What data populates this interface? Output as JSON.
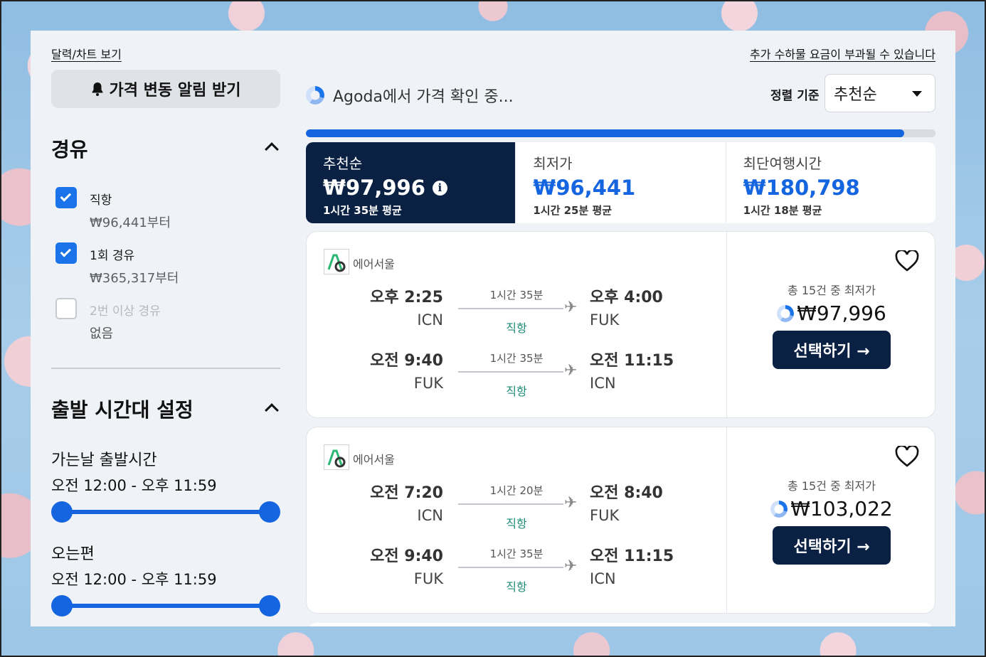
{
  "sidebar": {
    "calendar_link": "달력/차트 보기",
    "alert_button": "가격 변동 알림 받기",
    "stops": {
      "title": "경유",
      "options": [
        {
          "label": "직항",
          "price": "₩96,441부터",
          "checked": true,
          "disabled": false
        },
        {
          "label": "1회 경유",
          "price": "₩365,317부터",
          "checked": true,
          "disabled": false
        },
        {
          "label": "2번 이상 경유",
          "price": "없음",
          "checked": false,
          "disabled": true
        }
      ]
    },
    "departure_time": {
      "title": "출발 시간대 설정",
      "outbound_label": "가는날 출발시간",
      "outbound_range": "오전 12:00 - 오후 11:59",
      "return_label": "오는편",
      "return_range": "오전 12:00 - 오후 11:59"
    }
  },
  "header": {
    "baggage_notice": "추가 수하물 요금이 부과될 수 있습니다",
    "loading_text": "Agoda에서 가격 확인 중...",
    "sort_label": "정렬 기준",
    "sort_value": "추천순",
    "progress_fraction": 0.95
  },
  "tabs": [
    {
      "name": "추천순",
      "price": "₩97,996",
      "sub": "1시간 35분 평균",
      "active": true
    },
    {
      "name": "최저가",
      "price": "₩96,441",
      "sub": "1시간 25분 평균",
      "active": false
    },
    {
      "name": "최단여행시간",
      "price": "₩180,798",
      "sub": "1시간 18분 평균",
      "active": false
    }
  ],
  "flights": [
    {
      "airline": "에어서울",
      "legs": [
        {
          "dep_time": "오후 2:25",
          "dep_code": "ICN",
          "duration": "1시간 35분",
          "type": "직항",
          "arr_time": "오후 4:00",
          "arr_code": "FUK"
        },
        {
          "dep_time": "오전 9:40",
          "dep_code": "FUK",
          "duration": "1시간 35분",
          "type": "직항",
          "arr_time": "오전 11:15",
          "arr_code": "ICN"
        }
      ],
      "lowest_note": "총 15건 중 최저가",
      "price": "₩97,996",
      "select_label": "선택하기 →"
    },
    {
      "airline": "에어서울",
      "legs": [
        {
          "dep_time": "오전 7:20",
          "dep_code": "ICN",
          "duration": "1시간 20분",
          "type": "직항",
          "arr_time": "오전 8:40",
          "arr_code": "FUK"
        },
        {
          "dep_time": "오전 9:40",
          "dep_code": "FUK",
          "duration": "1시간 35분",
          "type": "직항",
          "arr_time": "오전 11:15",
          "arr_code": "ICN"
        }
      ],
      "lowest_note": "총 15건 중 최저가",
      "price": "₩103,022",
      "select_label": "선택하기 →"
    }
  ],
  "colors": {
    "accent": "#1565e0",
    "navy": "#0b2143",
    "direct_green": "#1a8a76"
  }
}
